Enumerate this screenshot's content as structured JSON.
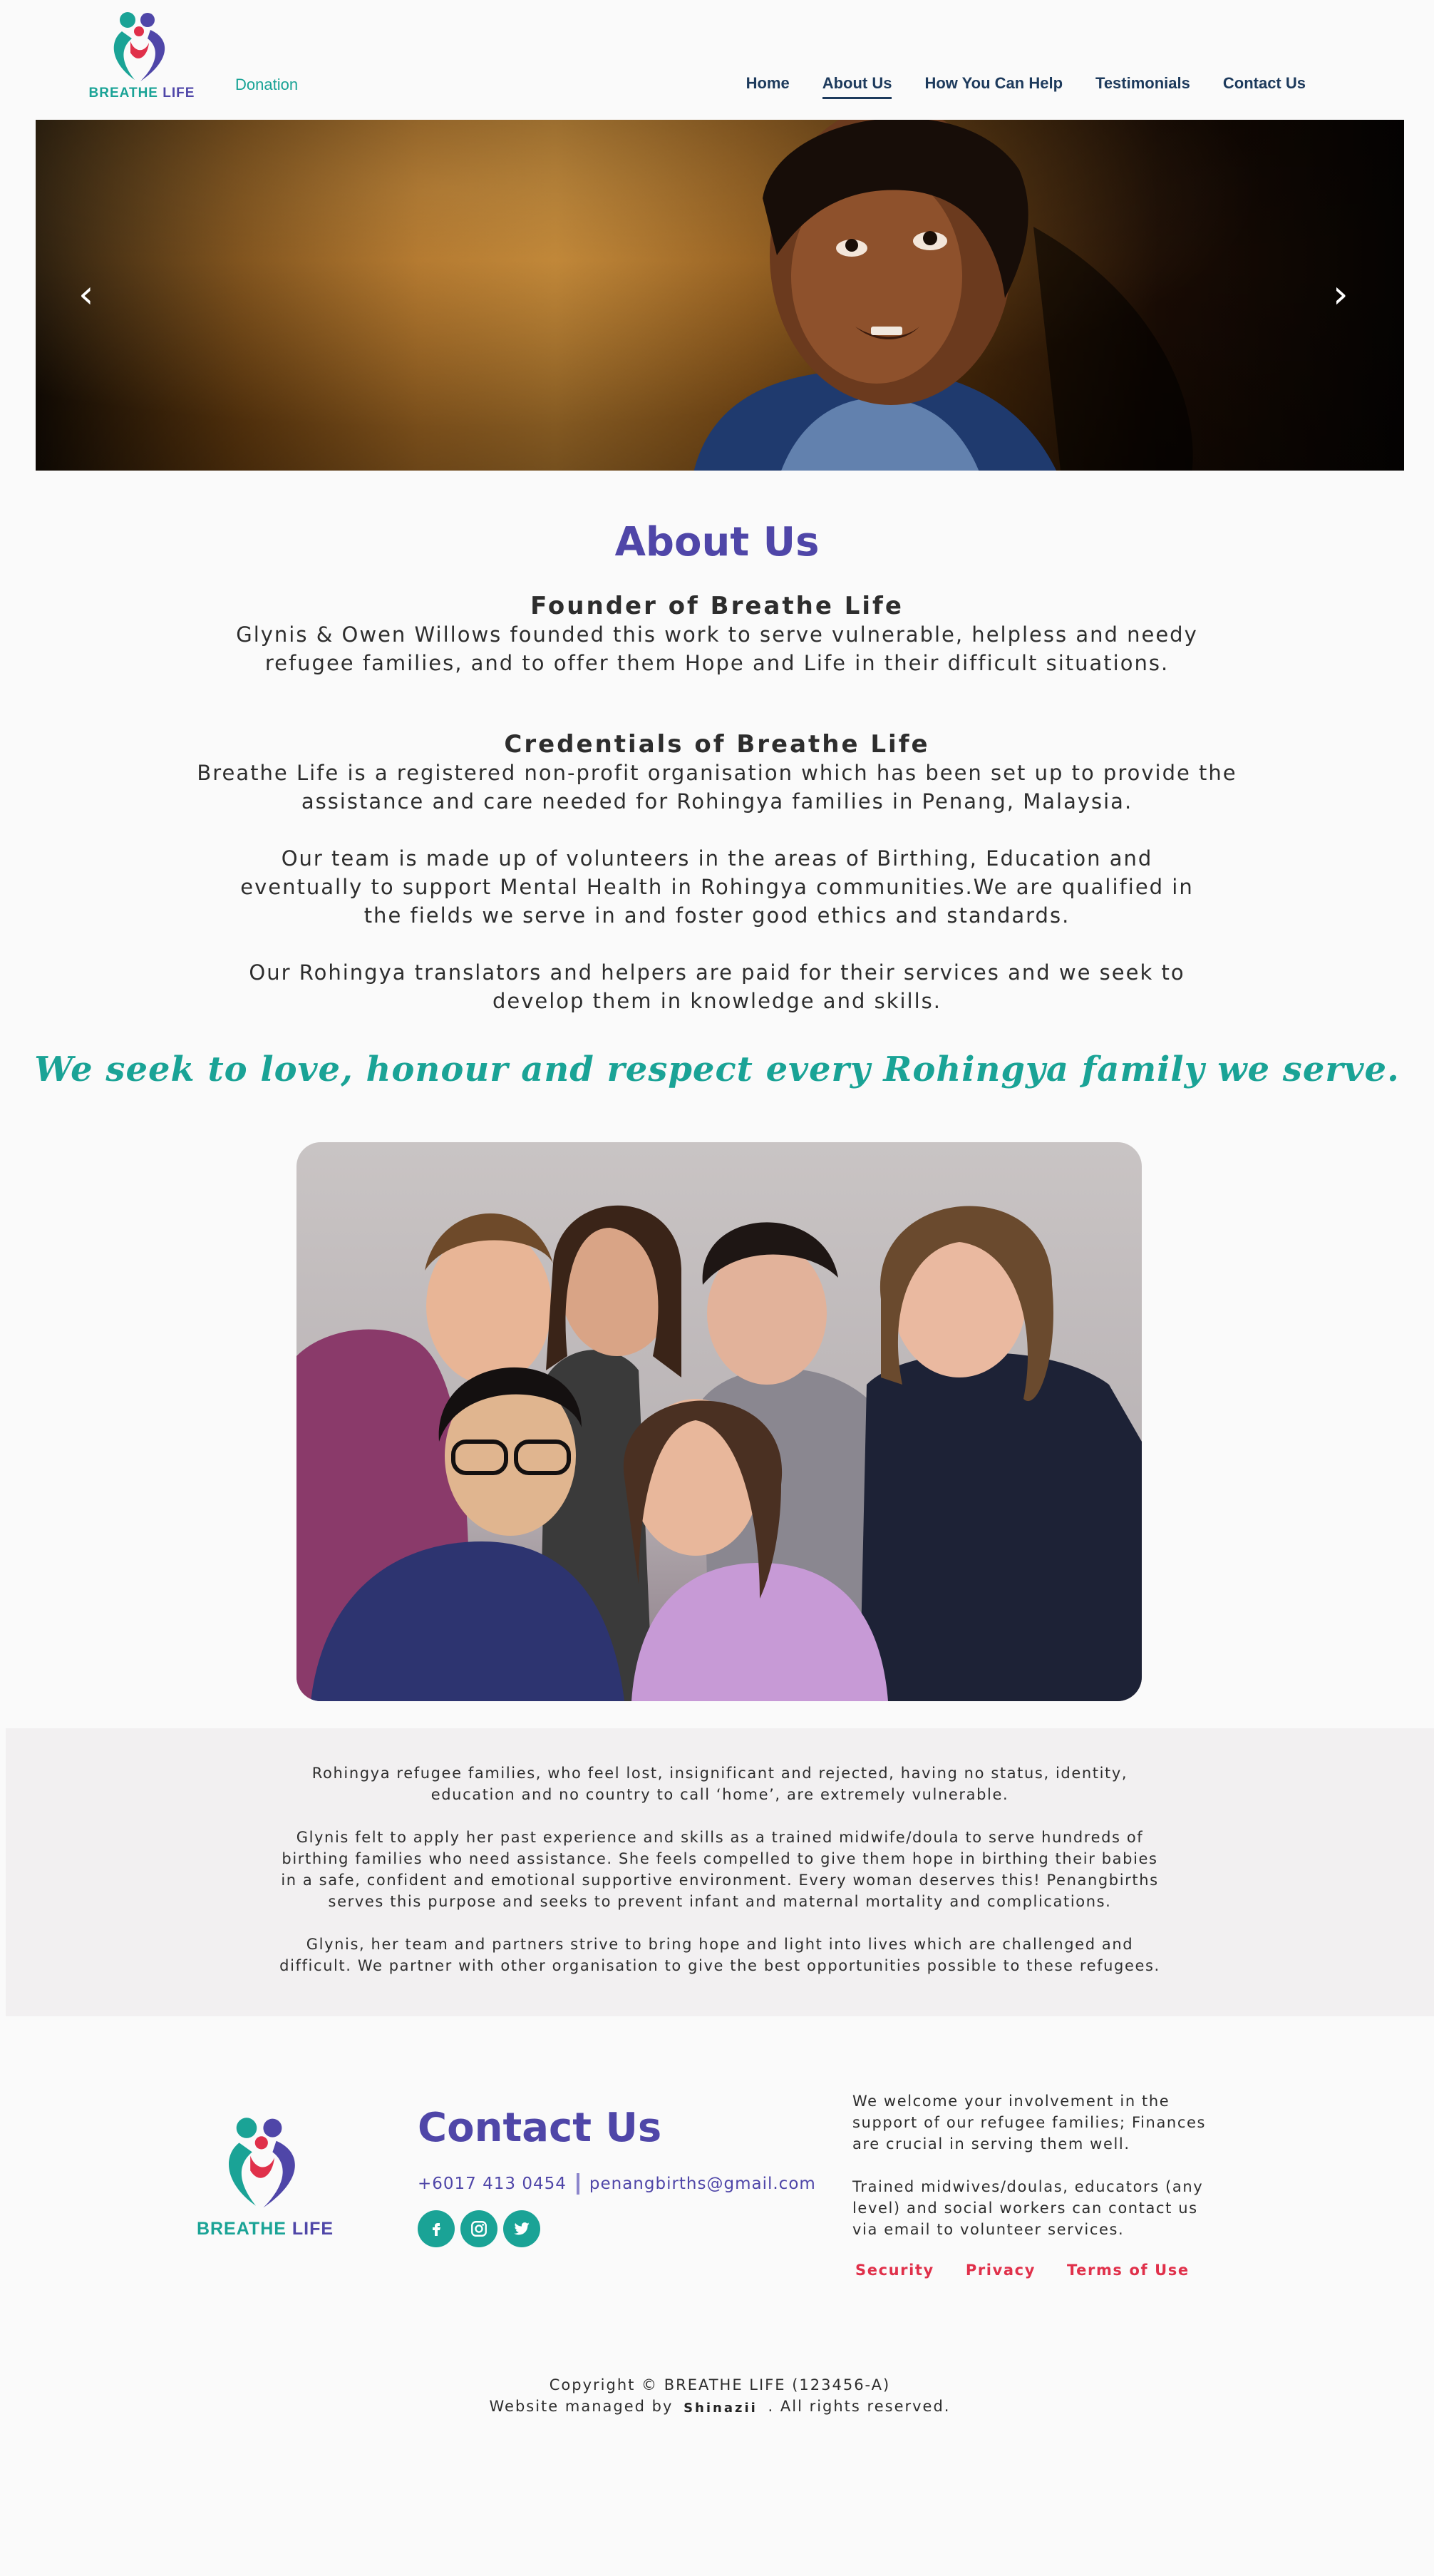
{
  "header": {
    "logo": {
      "word1": "BREATHE",
      "word2": "LIFE"
    },
    "donation_link": "Donation",
    "nav": [
      {
        "label": "Home",
        "active": false
      },
      {
        "label": "About Us",
        "active": true
      },
      {
        "label": "How You Can Help",
        "active": false
      },
      {
        "label": "Testimonials",
        "active": false
      },
      {
        "label": "Contact Us",
        "active": false
      }
    ]
  },
  "hero": {
    "prev_icon": "chevron-left-icon",
    "next_icon": "chevron-right-icon",
    "prev_glyph": "‹",
    "next_glyph": "›"
  },
  "about": {
    "title": "About Us",
    "founder_heading": "Founder of Breathe Life",
    "founder_text": "Glynis & Owen Willows founded this work to serve vulnerable, helpless and needy refugee families, and to offer them Hope and Life in their difficult situations.",
    "credentials_heading": "Credentials of Breathe Life",
    "credentials_p1": "Breathe Life is a registered non-profit organisation which has been set up to provide the assistance and care needed for Rohingya families in Penang, Malaysia.",
    "credentials_p2": "Our team is made up of volunteers in the areas of Birthing, Education and eventually to support Mental Health in Rohingya communities.We are qualified in the fields we serve in and foster good ethics and standards.",
    "credentials_p3": "Our Rohingya translators and helpers are paid for their services and we seek to develop them in knowledge and skills.",
    "tagline": "We seek to love, honour and respect every Rohingya family we serve."
  },
  "band": {
    "p1": "Rohingya refugee families, who feel lost, insignificant and rejected, having no status, identity, education and no country to call ‘home’, are extremely vulnerable.",
    "p2": "Glynis felt to apply her past experience and skills as a trained midwife/doula to serve hundreds of birthing families who need assistance. She feels compelled to give them hope in birthing their babies in a safe, confident and emotional supportive environment. Every woman deserves this! Penangbirths serves this purpose and seeks to prevent infant and maternal mortality and complications.",
    "p3": "Glynis, her team and partners strive to bring hope and light into lives which are challenged and difficult.  We partner with other organisation to give the best opportunities possible to these refugees."
  },
  "footer": {
    "logo": {
      "word1": "BREATHE",
      "word2": "LIFE"
    },
    "contact_title": "Contact Us",
    "phone": "+6017 413 0454",
    "email": "penangbirths@gmail.com",
    "socials": [
      {
        "icon": "facebook-icon",
        "glyph": "f"
      },
      {
        "icon": "instagram-icon",
        "glyph": "◎"
      },
      {
        "icon": "twitter-icon",
        "glyph": "🐦"
      }
    ],
    "right_p1": "We welcome your involvement in the support of our refugee families; Finances are crucial in serving them well.",
    "right_p2": "Trained midwives/doulas, educators (any level) and social workers can contact us via email to volunteer services.",
    "legal": [
      "Security",
      "Privacy",
      "Terms of Use"
    ],
    "copyright": "Copyright © BREATHE LIFE (123456-A)",
    "managed_prefix": "Website managed by",
    "managed_brand": "Shinazii",
    "managed_suffix": ". All rights reserved."
  },
  "colors": {
    "brand_purple": "#4f46a8",
    "brand_teal": "#1aa396",
    "brand_red": "#e0304a",
    "nav_navy": "#1d3a5c"
  }
}
